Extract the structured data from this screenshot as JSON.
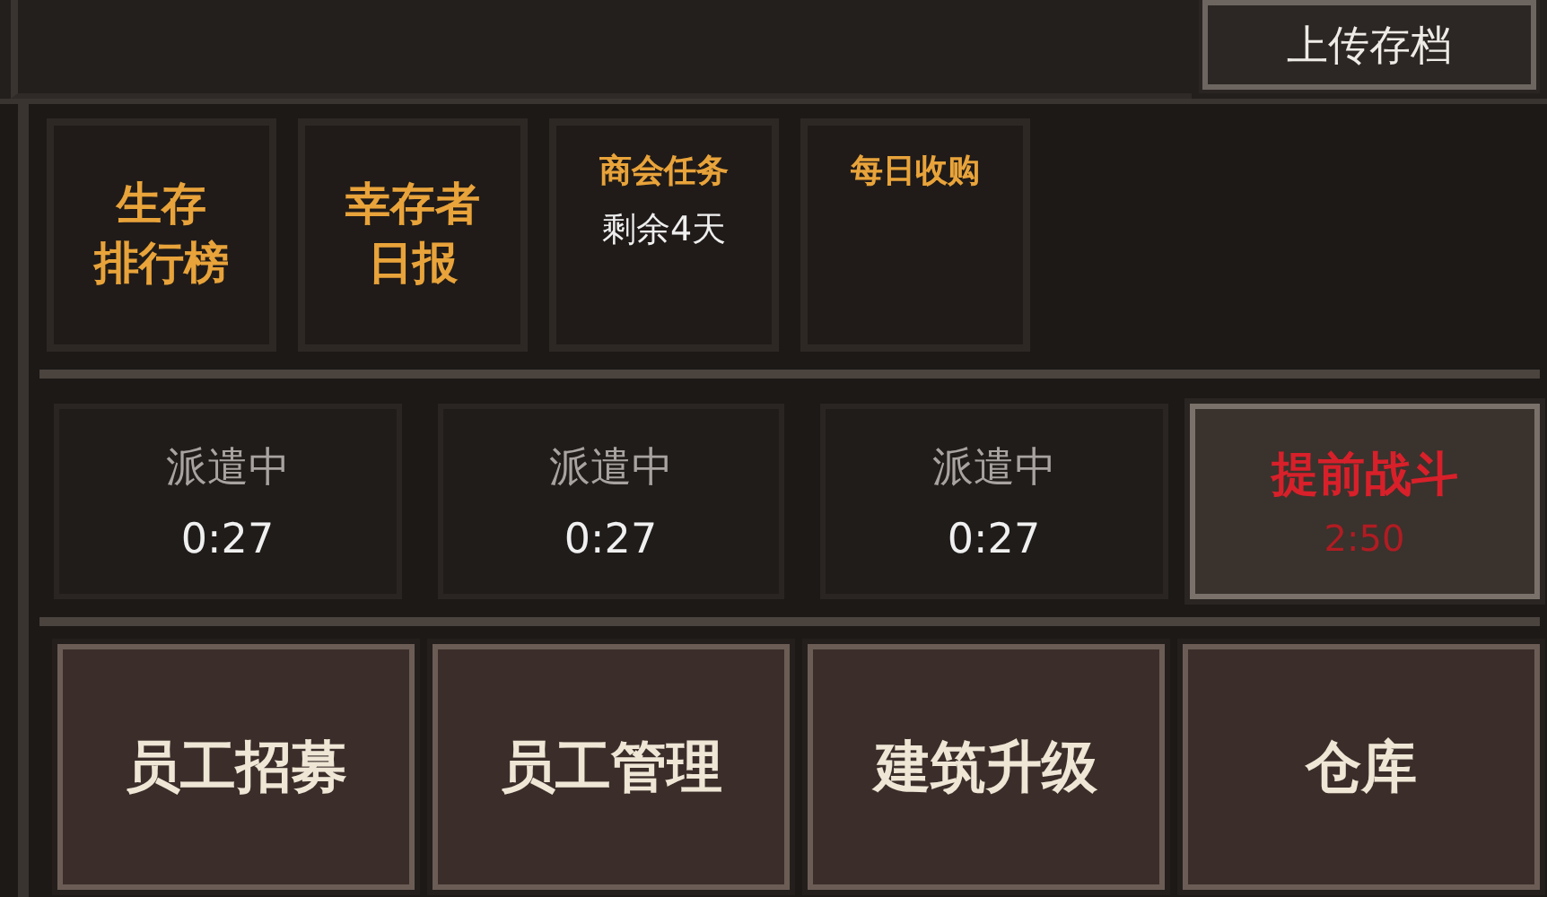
{
  "upload_button": "上传存档",
  "shortcuts": [
    {
      "lines": [
        "生存",
        "排行榜"
      ]
    },
    {
      "lines": [
        "幸存者",
        "日报"
      ]
    },
    {
      "lines": [
        "商会任务"
      ],
      "subtitle": "剩余4天"
    },
    {
      "lines": [
        "每日收购"
      ]
    }
  ],
  "dispatch_slots": [
    {
      "status": "派遣中",
      "timer": "0:27"
    },
    {
      "status": "派遣中",
      "timer": "0:27"
    },
    {
      "status": "派遣中",
      "timer": "0:27"
    }
  ],
  "battle_button": {
    "label": "提前战斗",
    "timer": "2:50"
  },
  "bottom_buttons": [
    "员工招募",
    "员工管理",
    "建筑升级",
    "仓库"
  ]
}
